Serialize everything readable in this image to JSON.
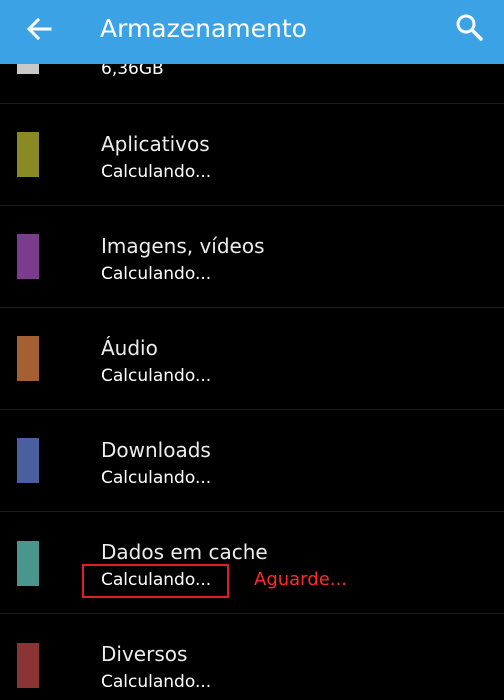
{
  "appbar": {
    "title": "Armazenamento",
    "back_icon": "arrow-left-icon",
    "search_icon": "search-icon",
    "color": "#3BA3E5"
  },
  "storage": {
    "partial_value": "6,36GB",
    "partial_color": "#c8c8c8",
    "items": [
      {
        "label": "Aplicativos",
        "value": "Calculando...",
        "color": "#8A8A25"
      },
      {
        "label": "Imagens, vídeos",
        "value": "Calculando...",
        "color": "#7A3C8C"
      },
      {
        "label": "Áudio",
        "value": "Calculando...",
        "color": "#A45F32"
      },
      {
        "label": "Downloads",
        "value": "Calculando...",
        "color": "#4A5F9F"
      },
      {
        "label": "Dados em cache",
        "value": "Calculando...",
        "color": "#4A958E"
      },
      {
        "label": "Diversos",
        "value": "Calculando...",
        "color": "#8B3434"
      }
    ]
  },
  "annotation": {
    "text": "Aguarde...",
    "color": "#ff2a2a"
  }
}
